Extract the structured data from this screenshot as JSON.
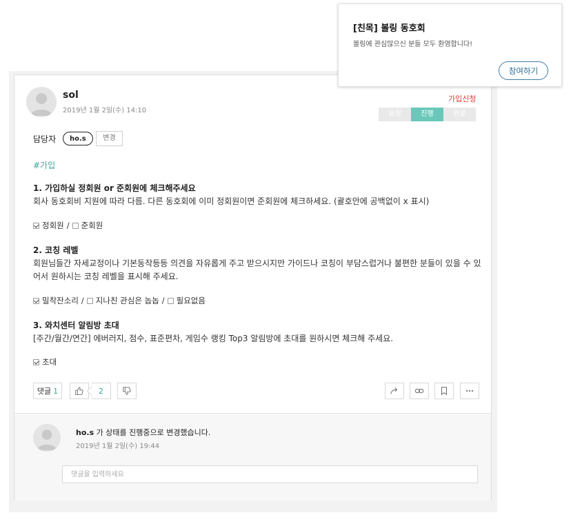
{
  "post": {
    "author": "sol",
    "date": "2019년 1월 2일(수) 14:10",
    "status_link": "가입신청",
    "progress_steps": [
      "요청",
      "진행",
      "완료"
    ],
    "active_step": "진행",
    "assignee_label": "담당자",
    "assignee": "ho.s",
    "change_label": "변경",
    "hashtag": "#가입"
  },
  "questions": [
    {
      "title": "1. 가입하실 정회원 or 준회원에 체크해주세요",
      "description": "회사 동호회비 지원에 따라 다름. 다른 동호회에 이미 정회원이면 준회원에 체크하세요. (괄호안에 공백없이 x 표시)",
      "options": [
        {
          "label": "정회원",
          "checked": true
        },
        {
          "label": "준회원",
          "checked": false
        }
      ]
    },
    {
      "title": "2. 코칭 레벨",
      "description": "회원님들간 자세교정이나 기본동작등등 의견을 자유롭게 주고 받으시지만 가이드나 코칭이 부담스럽거나 불편한 분들이 있을 수 있어서 원하시는 코칭 레벨을 표시해 주세요.",
      "options": [
        {
          "label": "밀착잔소리",
          "checked": true
        },
        {
          "label": "지나친 관심은 놉놉",
          "checked": false
        },
        {
          "label": "필요없음",
          "checked": false
        }
      ]
    },
    {
      "title": "3. 와치센터 알림방 초대",
      "description": "[주간/월간/연간] 에버러지, 점수, 표준편차, 게임수 랭킹 Top3 알림방에 초대를 원하시면 체크해 주세요.",
      "options": [
        {
          "label": "초대",
          "checked": true
        }
      ]
    }
  ],
  "toolbar": {
    "comments_label": "댓글",
    "comments_count": "1",
    "likes_count": "2",
    "icons": [
      "thumbs-up-icon",
      "thumbs-down-icon",
      "share-icon",
      "link-icon",
      "bookmark-icon",
      "more-icon"
    ]
  },
  "activity": {
    "user": "ho.s",
    "text": " 가 상태를 진행중으로 변경했습니다.",
    "date": "2019년 1월 2일(수) 19:44"
  },
  "comment_input": {
    "placeholder": "댓글을 입력하세요"
  },
  "popup": {
    "title": "[친목] 볼링 동호회",
    "description": "볼링에 관심많으신 분들 모두 환영합니다!",
    "join_label": "참여하기"
  },
  "colors": {
    "accent_teal": "#6ac8ba",
    "hashtag": "#3aa89a",
    "status_red": "#e03a3a",
    "join_blue": "#2e6b94"
  }
}
